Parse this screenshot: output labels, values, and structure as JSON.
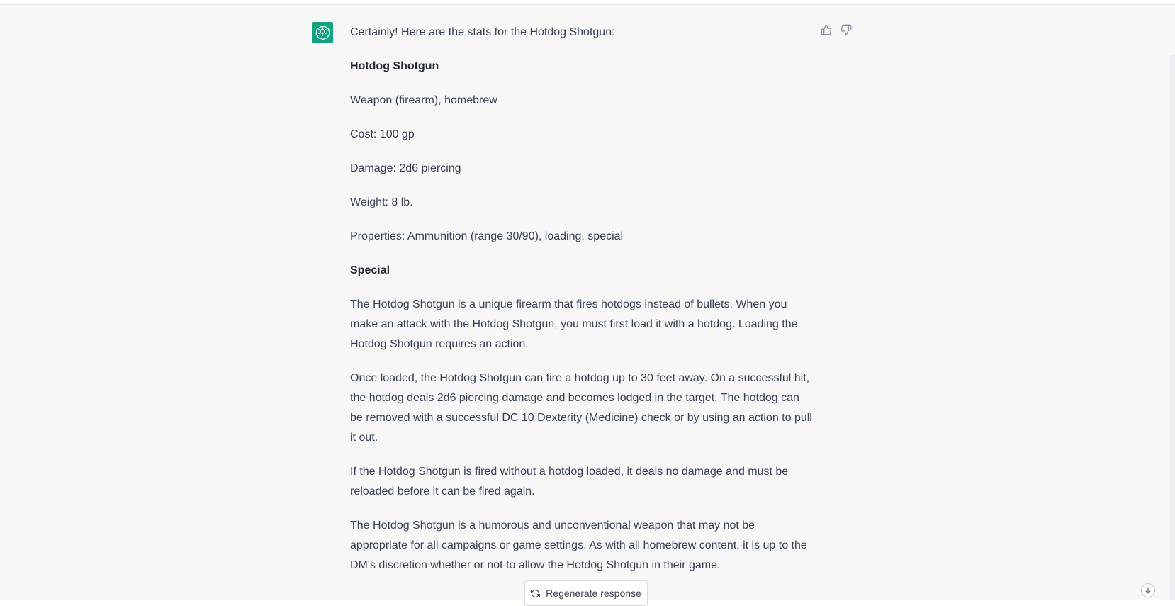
{
  "response": {
    "intro": "Certainly! Here are the stats for the Hotdog Shotgun:",
    "heading": "Hotdog Shotgun",
    "type_line": "Weapon (firearm), homebrew",
    "cost": "Cost: 100 gp",
    "damage": "Damage: 2d6 piercing",
    "weight": "Weight: 8 lb.",
    "properties": "Properties: Ammunition (range 30/90), loading, special",
    "special_heading": "Special",
    "paragraphs": [
      "The Hotdog Shotgun is a unique firearm that fires hotdogs instead of bullets. When you make an attack with the Hotdog Shotgun, you must first load it with a hotdog. Loading the Hotdog Shotgun requires an action.",
      "Once loaded, the Hotdog Shotgun can fire a hotdog up to 30 feet away. On a successful hit, the hotdog deals 2d6 piercing damage and becomes lodged in the target. The hotdog can be removed with a successful DC 10 Dexterity (Medicine) check or by using an action to pull it out.",
      "If the Hotdog Shotgun is fired without a hotdog loaded, it deals no damage and must be reloaded before it can be fired again.",
      "The Hotdog Shotgun is a humorous and unconventional weapon that may not be appropriate for all campaigns or game settings. As with all homebrew content, it is up to the DM's discretion whether or not to allow the Hotdog Shotgun in their game."
    ]
  },
  "actions": {
    "regenerate_label": "Regenerate response"
  },
  "icons": {
    "avatar": "openai-logo-icon",
    "thumbs_up": "thumbs-up-icon",
    "thumbs_down": "thumbs-down-icon",
    "regenerate": "refresh-icon",
    "scroll_down": "arrow-down-icon"
  },
  "colors": {
    "avatar_bg": "#10a37f",
    "message_bg": "#f7f7f8",
    "text": "#374151"
  }
}
